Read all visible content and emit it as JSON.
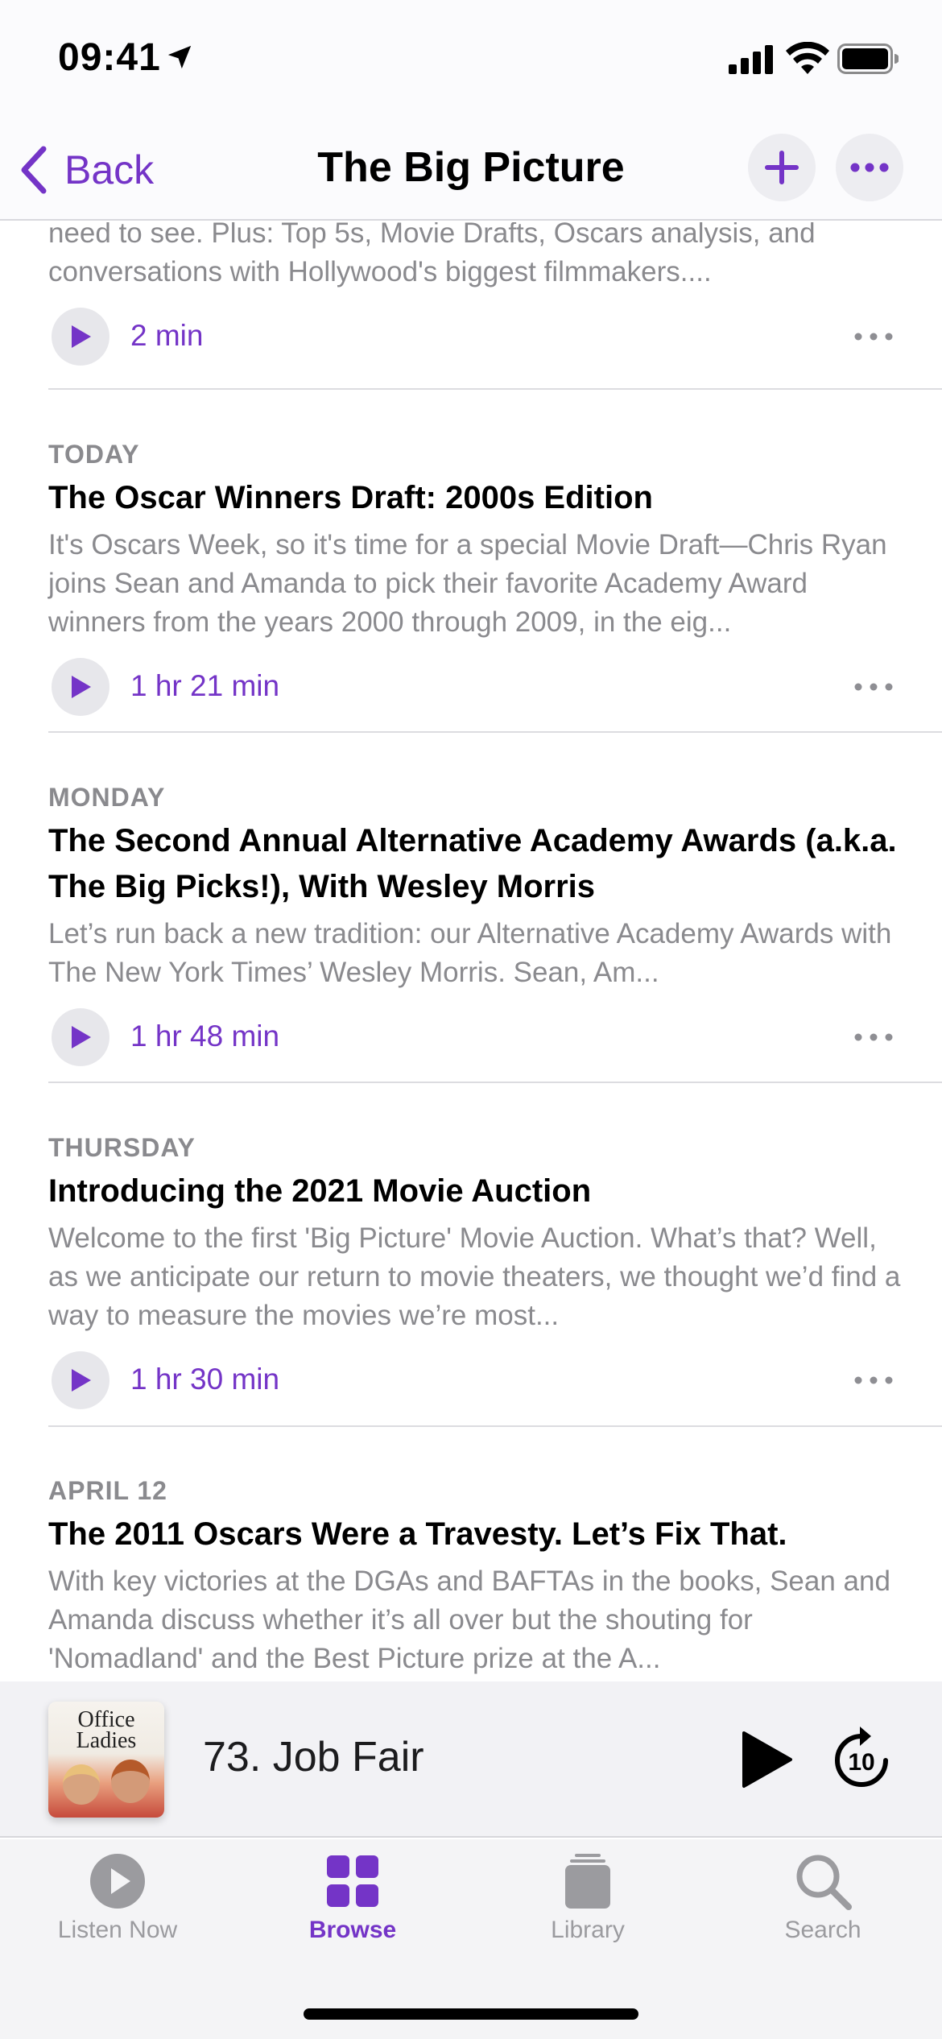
{
  "status_bar": {
    "time": "09:41"
  },
  "nav": {
    "back_label": "Back",
    "title": "The Big Picture"
  },
  "episodes": [
    {
      "date": "",
      "title": "",
      "description": "need to see. Plus: Top 5s, Movie Drafts, Oscars analysis, and conversations with Hollywood's biggest filmmakers....",
      "duration": "2 min"
    },
    {
      "date": "TODAY",
      "title": "The Oscar Winners Draft: 2000s Edition",
      "description": "It's Oscars Week, so it's time for a special Movie Draft—Chris Ryan joins Sean and Amanda to pick their favorite Academy Award winners from the years 2000 through 2009, in the eig...",
      "duration": "1 hr 21 min"
    },
    {
      "date": "MONDAY",
      "title": "The Second Annual Alternative Academy Awards (a.k.a. The Big Picks!), With Wesley Morris",
      "description": "Let’s run back a new tradition: our Alternative Academy Awards with The New York Times’ Wesley Morris. Sean, Am...",
      "duration": "1 hr 48 min"
    },
    {
      "date": "THURSDAY",
      "title": "Introducing the 2021 Movie Auction",
      "description": "Welcome to the first 'Big Picture' Movie Auction. What’s that? Well, as we anticipate our return to movie theaters, we thought we’d find a way to measure the movies we’re most...",
      "duration": "1 hr 30 min"
    },
    {
      "date": "APRIL 12",
      "title": "The 2011 Oscars Were a Travesty. Let’s Fix That.",
      "description": "With key victories at the DGAs and BAFTAs in the books, Sean and Amanda discuss whether it’s all over but the shouting for 'Nomadland' and the Best Picture prize at the A...",
      "duration": ""
    }
  ],
  "mini_player": {
    "artwork_title": "Office Ladies",
    "episode_title": "73. Job Fair",
    "skip_seconds": "10"
  },
  "tabs": [
    {
      "label": "Listen Now",
      "icon": "play-circle-icon",
      "active": false
    },
    {
      "label": "Browse",
      "icon": "grid-icon",
      "active": true
    },
    {
      "label": "Library",
      "icon": "library-stack-icon",
      "active": false
    },
    {
      "label": "Search",
      "icon": "search-icon",
      "active": false
    }
  ],
  "colors": {
    "accent": "#7434c7",
    "secondary_text": "#8a8a8e",
    "inactive_tab": "#9b9b9f"
  }
}
